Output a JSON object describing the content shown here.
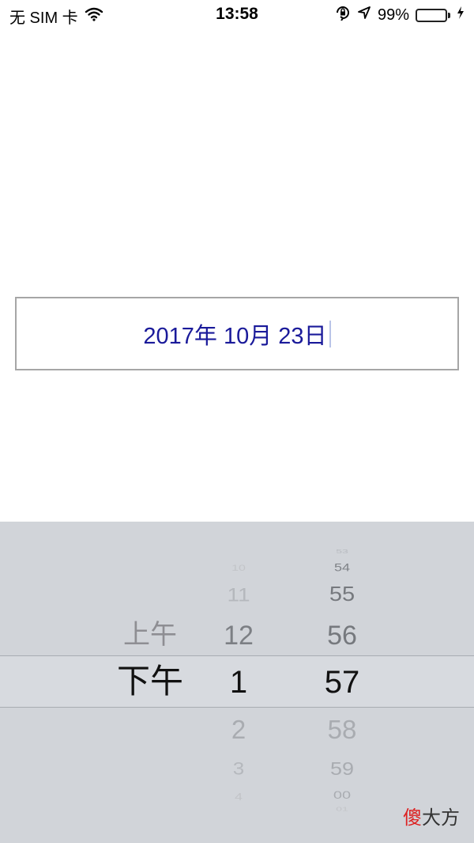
{
  "status_bar": {
    "carrier": "无 SIM 卡",
    "time": "13:58",
    "battery_percent": "99%",
    "battery_level": 0.99,
    "icons": [
      "wifi-icon",
      "orientation-lock-icon",
      "location-arrow-icon",
      "battery-icon",
      "charging-bolt-icon"
    ]
  },
  "date_field": {
    "value": "2017年 10月 23日",
    "text_color": "#1a1a9a"
  },
  "picker": {
    "ampm": {
      "above": "上午",
      "selected": "下午"
    },
    "hours": {
      "above": [
        "10",
        "11",
        "12"
      ],
      "selected": "1",
      "below": [
        "2",
        "3",
        "4"
      ]
    },
    "minutes": {
      "above": [
        "53",
        "54",
        "55",
        "56"
      ],
      "selected": "57",
      "below": [
        "58",
        "59",
        "00",
        "01"
      ]
    },
    "background_color": "#d1d4d9"
  },
  "watermark": {
    "char1": "傻",
    "rest": "大方"
  }
}
